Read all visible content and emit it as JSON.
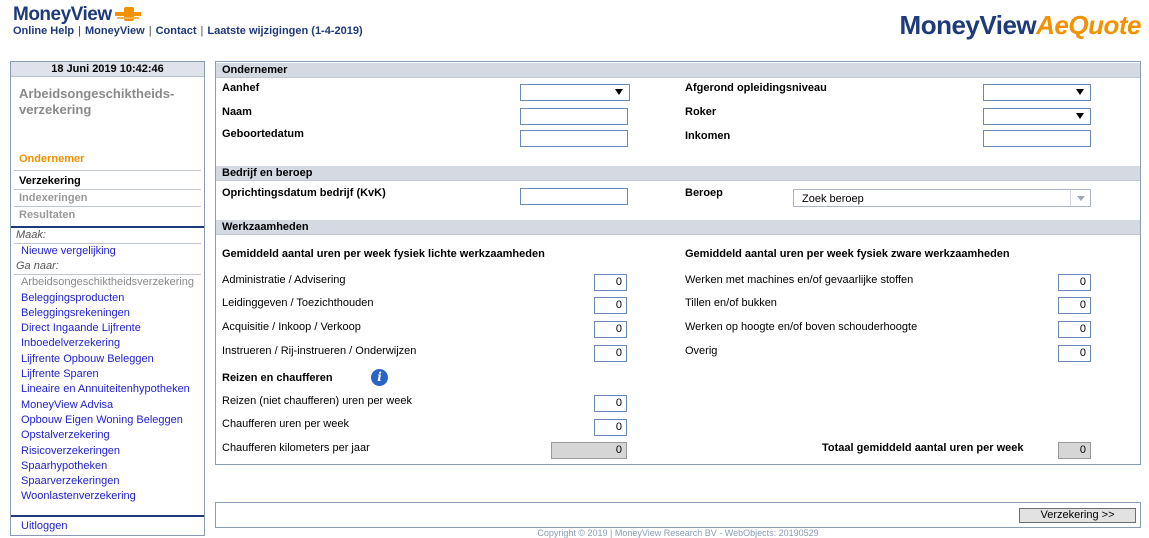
{
  "header": {
    "logo": "MoneyView",
    "nav": [
      "Online Help",
      "MoneyView",
      "Contact",
      "Laatste wijzigingen (1-4-2019)"
    ],
    "brand_main": "MoneyView",
    "brand_accent": "AeQuote"
  },
  "sidebar": {
    "datetime": "18 Juni 2019  10:42:46",
    "title": "Arbeidsongeschiktheids-verzekering",
    "steps": [
      "Ondernemer",
      "Verzekering",
      "Indexeringen",
      "Resultaten"
    ],
    "maak_label": "Maak:",
    "maak_link": "Nieuwe vergelijking",
    "ganaar_label": "Ga naar:",
    "links": [
      "Arbeidsongeschiktheidsverzekering",
      "Beleggingsproducten",
      "Beleggingsrekeningen",
      "Direct Ingaande Lijfrente",
      "Inboedelverzekering",
      "Lijfrente Opbouw Beleggen",
      "Lijfrente Sparen",
      "Lineaire en Annuiteitenhypotheken",
      "MoneyView Advisa",
      "Opbouw Eigen Woning Beleggen",
      "Opstalverzekering",
      "Risicoverzekeringen",
      "Spaarhypotheken",
      "Spaarverzekeringen",
      "Woonlastenverzekering"
    ],
    "logout": "Uitloggen"
  },
  "ondernemer": {
    "heading": "Ondernemer",
    "aanhef": "Aanhef",
    "naam": "Naam",
    "geboortedatum": "Geboortedatum",
    "opleiding": "Afgerond opleidingsniveau",
    "roker": "Roker",
    "inkomen": "Inkomen"
  },
  "bedrijf": {
    "heading": "Bedrijf en beroep",
    "oprichting": "Oprichtingsdatum bedrijf (KvK)",
    "beroep": "Beroep",
    "beroep_placeholder": "Zoek beroep"
  },
  "werk": {
    "heading": "Werkzaamheden",
    "licht_heading": "Gemiddeld aantal uren per week fysiek lichte werkzaamheden",
    "zwaar_heading": "Gemiddeld aantal uren per week fysiek zware werkzaamheden",
    "licht": [
      {
        "label": "Administratie / Advisering",
        "value": "0"
      },
      {
        "label": "Leidinggeven / Toezichthouden",
        "value": "0"
      },
      {
        "label": "Acquisitie / Inkoop / Verkoop",
        "value": "0"
      },
      {
        "label": "Instrueren / Rij-instrueren / Onderwijzen",
        "value": "0"
      }
    ],
    "zwaar": [
      {
        "label": "Werken met machines en/of gevaarlijke stoffen",
        "value": "0"
      },
      {
        "label": "Tillen en/of bukken",
        "value": "0"
      },
      {
        "label": "Werken op hoogte en/of boven schouderhoogte",
        "value": "0"
      },
      {
        "label": "Overig",
        "value": "0"
      }
    ],
    "reizen_heading": "Reizen en chaufferen",
    "reizen": [
      {
        "label": "Reizen (niet chaufferen) uren per week",
        "value": "0"
      },
      {
        "label": "Chaufferen uren per week",
        "value": "0"
      }
    ],
    "km_label": "Chaufferen kilometers per jaar",
    "km_value": "0",
    "totaal_label": "Totaal gemiddeld aantal uren per week",
    "totaal_value": "0"
  },
  "footer": {
    "next_button": "Verzekering >>",
    "copyright": "Copyright © 2019 | MoneyView Research BV - WebObjects: 20190529"
  },
  "colors": {
    "brand_blue": "#1e3a78",
    "brand_orange": "#f29200",
    "link_blue": "#2222cc"
  }
}
